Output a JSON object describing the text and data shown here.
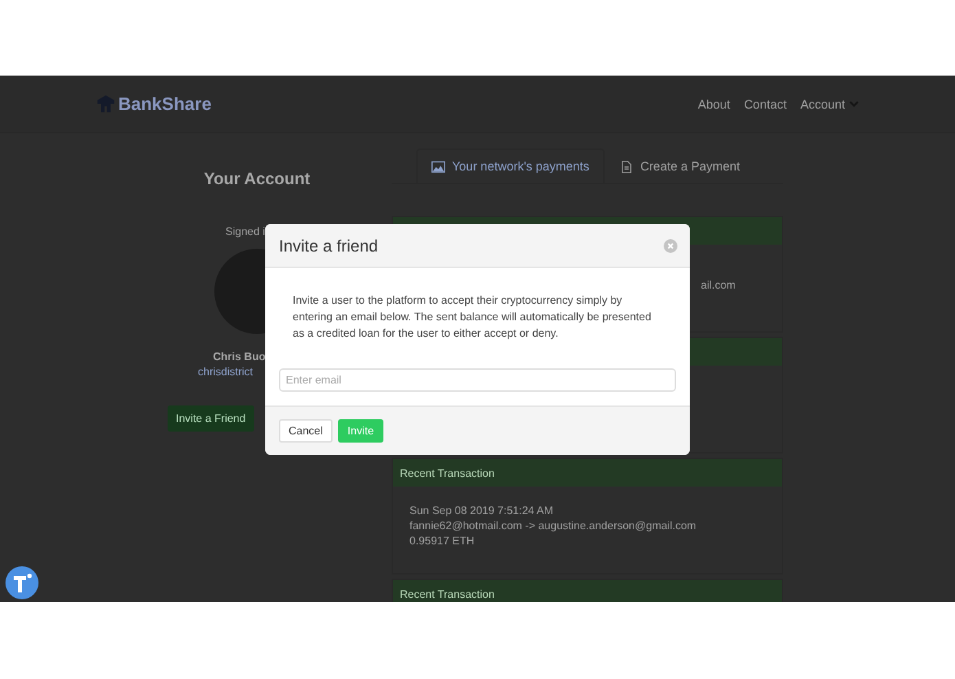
{
  "navbar": {
    "brand": "BankShare",
    "links": [
      {
        "label": "About",
        "kind": "link"
      },
      {
        "label": "Contact",
        "kind": "link"
      },
      {
        "label": "Account",
        "kind": "dropdown"
      }
    ]
  },
  "account": {
    "title": "Your Account",
    "signed_in": "Signed i",
    "name": "Chris Buo",
    "email": "chrisdistrict",
    "button": "Invite a Friend"
  },
  "tabs": [
    {
      "label": "Your network's payments",
      "selected": true
    },
    {
      "label": "Create a Payment",
      "selected": false
    }
  ],
  "cards": [
    {
      "kind": "covered",
      "lines": [
        "ail.com"
      ]
    },
    {
      "kind": "covered"
    },
    {
      "kind": "open",
      "header": "Recent Transaction",
      "lines": [
        "Sun Sep 08 2019 7:51:24 AM",
        "fannie62@hotmail.com -> augustine.anderson@gmail.com",
        "0.95917 ETH"
      ]
    },
    {
      "kind": "open",
      "header": "Recent Transaction"
    }
  ],
  "modal": {
    "title": "Invite a friend",
    "message": "Invite a user to the platform to accept their cryptocurrency simply by entering an email below. The sent balance will automatically be presented as a credited loan for the user to either accept or deny.",
    "placeholder": "Enter email",
    "buttons": [
      {
        "label": "Cancel",
        "kind": "secondary"
      },
      {
        "label": "Invite",
        "kind": "primary"
      }
    ]
  }
}
